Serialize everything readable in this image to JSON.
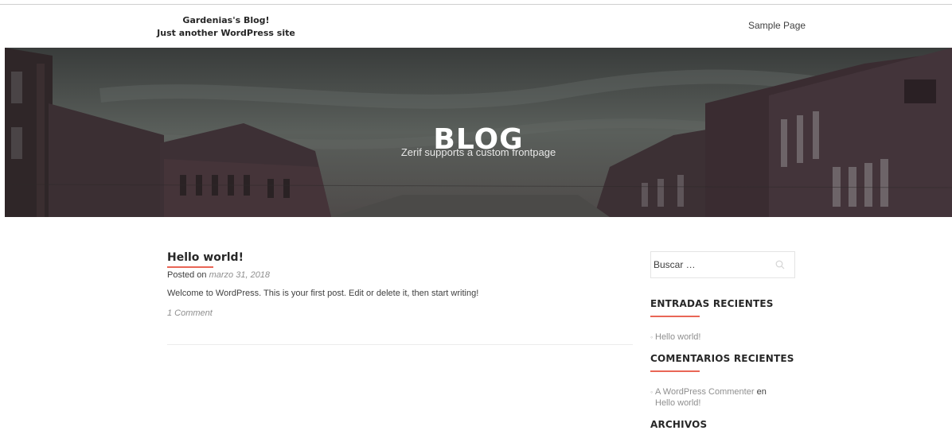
{
  "site": {
    "title": "Gardenias's Blog!",
    "tagline": "Just another WordPress site"
  },
  "nav": {
    "items": [
      {
        "label": "Sample Page"
      }
    ]
  },
  "hero": {
    "title": "BLOG",
    "subtitle": "Zerif supports a custom frontpage"
  },
  "post": {
    "title": "Hello world!",
    "meta_prefix": "Posted on",
    "date": "marzo 31, 2018",
    "excerpt": "Welcome to WordPress. This is your first post. Edit or delete it, then start writing!",
    "comments": "1 Comment"
  },
  "sidebar": {
    "search": {
      "placeholder": "Buscar …"
    },
    "recent_posts": {
      "title": "ENTRADAS RECIENTES",
      "items": [
        {
          "label": "Hello world!"
        }
      ]
    },
    "recent_comments": {
      "title": "COMENTARIOS RECIENTES",
      "items": [
        {
          "author": "A WordPress Commenter",
          "connector": "en",
          "post": "Hello world!"
        }
      ]
    },
    "archives": {
      "title": "ARCHIVOS"
    }
  },
  "colors": {
    "accent": "#e96656",
    "heading": "#272727",
    "text": "#404040",
    "muted": "#8f8f8f"
  },
  "icons": {
    "search": "search-icon"
  }
}
